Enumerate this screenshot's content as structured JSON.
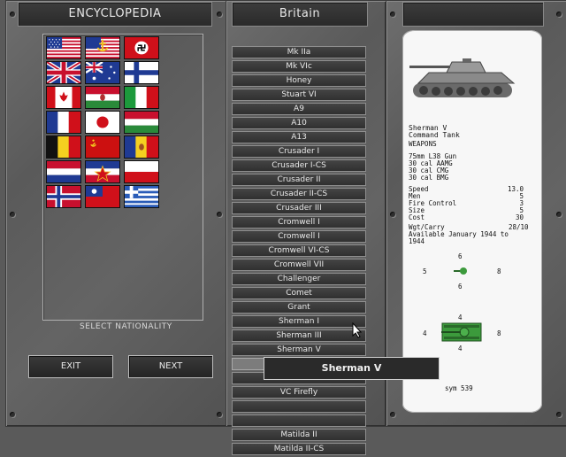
{
  "left_panel": {
    "title": "ENCYCLOPEDIA",
    "caption": "SELECT NATIONALITY",
    "exit_label": "EXIT",
    "next_label": "NEXT",
    "flags": [
      {
        "name": "usa-flag"
      },
      {
        "name": "usa-navy-flag"
      },
      {
        "name": "germany-flag"
      },
      {
        "name": "uk-flag"
      },
      {
        "name": "australia-flag"
      },
      {
        "name": "finland-flag"
      },
      {
        "name": "canada-flag"
      },
      {
        "name": "hungary-flag"
      },
      {
        "name": "italy-flag"
      },
      {
        "name": "france-flag"
      },
      {
        "name": "japan-flag"
      },
      {
        "name": "hungary-alt-flag"
      },
      {
        "name": "belgium-flag"
      },
      {
        "name": "ussr-flag"
      },
      {
        "name": "romania-flag"
      },
      {
        "name": "netherlands-flag"
      },
      {
        "name": "yugoslavia-flag"
      },
      {
        "name": "poland-flag"
      },
      {
        "name": "norway-flag"
      },
      {
        "name": "china-flag"
      },
      {
        "name": "greece-flag"
      }
    ]
  },
  "middle_panel": {
    "title": "Britain",
    "units": [
      "Mk IIa",
      "Mk VIc",
      "Honey",
      "Stuart VI",
      "A9",
      "A10",
      "A13",
      "Crusader I",
      "Crusader I-CS",
      "Crusader II",
      "Crusader II-CS",
      "Crusader III",
      "Cromwell I",
      "Cromwell I",
      "Cromwell VI-CS",
      "Cromwell VII",
      "Challenger",
      "Comet",
      "Grant",
      "Sherman I",
      "Sherman III",
      "Sherman V",
      "Sherman V",
      "Sherman DD",
      "VC Firefly",
      "",
      "",
      "Matilda II",
      "Matilda II-CS"
    ],
    "selected_index": 22,
    "tooltip": "Sherman V"
  },
  "unit_card": {
    "name": "Sherman V",
    "type": "Command Tank",
    "weapons_header": "WEAPONS",
    "weapons": [
      "75mm L38 Gun",
      "30 cal AAMG",
      "30 cal CMG",
      "30 cal BMG"
    ],
    "stats": [
      {
        "label": "Speed",
        "value": "13.0"
      },
      {
        "label": "Men",
        "value": "5"
      },
      {
        "label": "Fire Control",
        "value": "3"
      },
      {
        "label": "Size",
        "value": "5"
      },
      {
        "label": "Cost",
        "value": "30"
      }
    ],
    "wgt_label": "Wgt/Carry",
    "wgt_value": "28/10",
    "available_line1": "Available January 1944 to",
    "available_line2": "1944",
    "hardness_top": {
      "top": "6",
      "left": "5",
      "right": "8",
      "bottom": "6"
    },
    "armor_hull": {
      "top": "4",
      "left": "4",
      "right": "8",
      "bottom": "4"
    },
    "sym": "sym 539",
    "colors": {
      "tank_green": "#3c9a3c"
    }
  }
}
